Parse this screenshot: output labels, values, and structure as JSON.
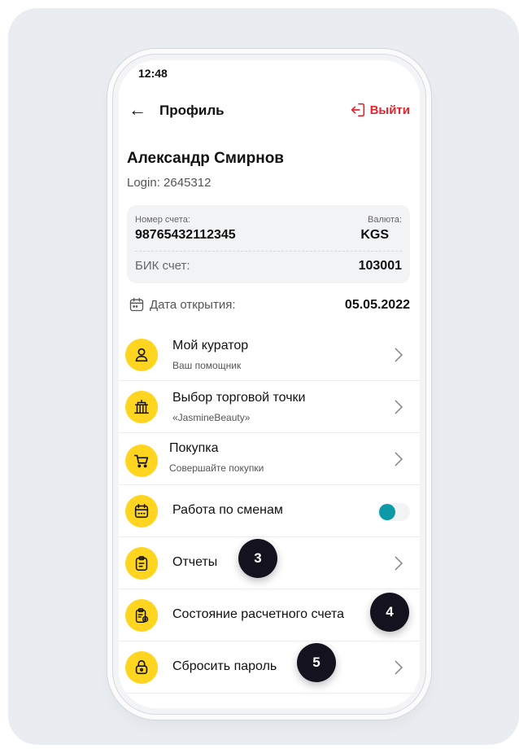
{
  "status_bar": {
    "time": "12:48"
  },
  "header": {
    "title": "Профиль",
    "logout_label": "Выйти"
  },
  "user": {
    "name": "Александр Смирнов",
    "login": "Login: 2645312"
  },
  "account": {
    "number_label": "Номер счета:",
    "number_value": "98765432112345",
    "currency_label": "Валюта:",
    "currency_value": "KGS",
    "bik_label": "БИК счет:",
    "bik_value": "103001"
  },
  "open_date": {
    "label": "Дата открытия:",
    "value": "05.05.2022"
  },
  "menu": [
    {
      "title": "Мой куратор",
      "subtitle": "Ваш помощник",
      "icon": "user-icon"
    },
    {
      "title": "Выбор торговой точки",
      "subtitle": "«JasmineBeauty»",
      "icon": "store-icon"
    },
    {
      "title": "Покупка",
      "subtitle": "Совершайте покупки",
      "icon": "cart-icon"
    },
    {
      "title": "Работа по сменам",
      "icon": "calendar-icon",
      "toggle_on": true
    },
    {
      "title": "Отчеты",
      "icon": "clipboard-icon"
    },
    {
      "title": "Состояние расчетного счета",
      "icon": "account-status-icon"
    },
    {
      "title": "Сбросить пароль",
      "icon": "lock-icon"
    }
  ],
  "step_badges": [
    "3",
    "4",
    "5"
  ],
  "colors": {
    "accent_yellow": "#ffd51f",
    "logout_red": "#e0262f",
    "toggle_teal": "#0c9aa8",
    "badge_dark": "#14121f"
  }
}
